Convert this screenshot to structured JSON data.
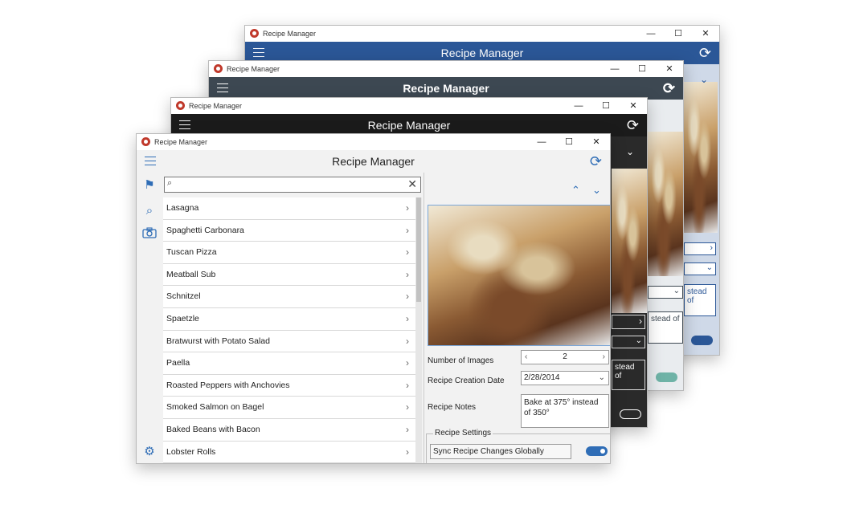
{
  "app": {
    "title": "Recipe Manager",
    "window_controls": {
      "minimize": "—",
      "maximize": "☐",
      "close": "✕"
    }
  },
  "colors": {
    "accent": "#2f6db6",
    "blue_theme": "#2b5797",
    "slate_theme": "#3d4852",
    "dark_theme": "#1b1b1b"
  },
  "nav": {
    "icons": [
      "hamburger-icon",
      "flag-icon",
      "search-icon",
      "camera-icon",
      "gear-icon"
    ]
  },
  "search": {
    "value": "",
    "placeholder": ""
  },
  "recipes": [
    "Lasagna",
    "Spaghetti Carbonara",
    "Tuscan Pizza",
    "Meatball Sub",
    "Schnitzel",
    "Spaetzle",
    "Bratwurst with Potato Salad",
    "Paella",
    "Roasted Peppers with Anchovies",
    "Smoked Salmon on Bagel",
    "Baked Beans with Bacon",
    "Lobster Rolls"
  ],
  "detail": {
    "number_of_images_label": "Number of Images",
    "number_of_images_value": "2",
    "creation_date_label": "Recipe Creation Date",
    "creation_date_value": "2/28/2014",
    "notes_label": "Recipe Notes",
    "notes_value": "Bake at 375° instead of 350°",
    "settings_legend": "Recipe Settings",
    "sync_label": "Sync Recipe Changes Globally",
    "sync_enabled": true
  },
  "background_fragments": {
    "w1_notes": "stead of",
    "w2_notes": "stead of",
    "w3_notes": "stead of"
  }
}
